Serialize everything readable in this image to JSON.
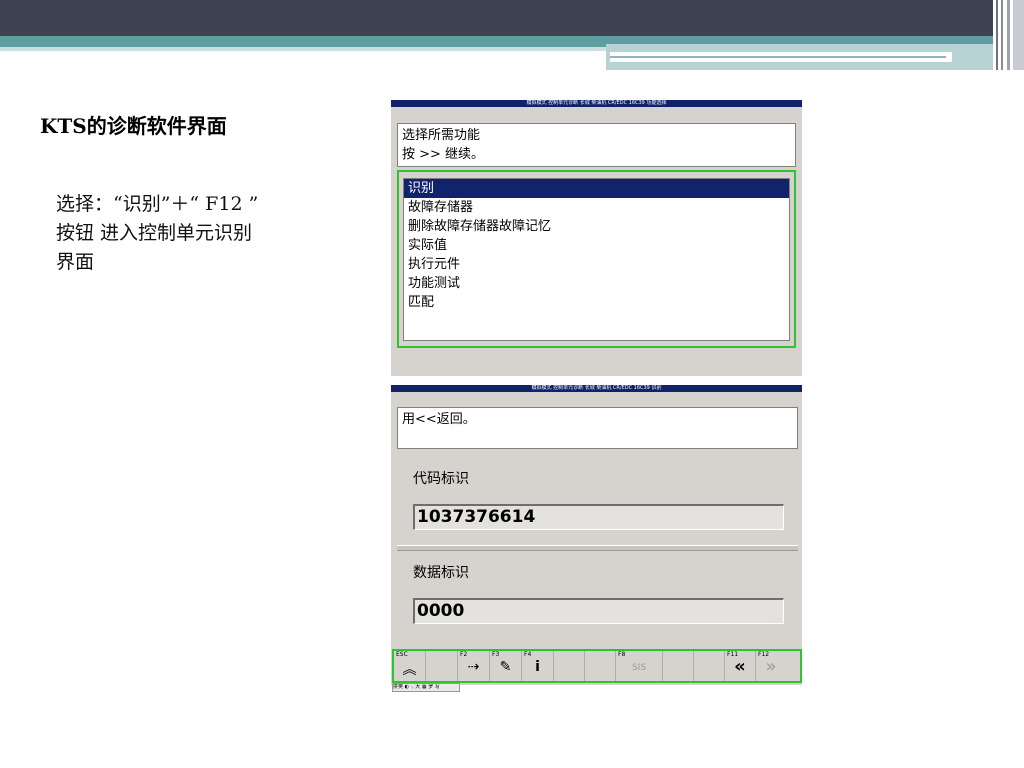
{
  "slide": {
    "title": "KTS的诊断软件界面",
    "body_lines": [
      "选择：“识别”＋“ F12 ”",
      "按钮 进入控制单元识别",
      "界面"
    ],
    "accent_dark": "#3f4251",
    "accent_teal": "#5e9ea0"
  },
  "screen1": {
    "title": "模拟模式 控制单元诊断 长城 柴油机 CR/EDC 16C39 功能选择",
    "instructions": [
      "选择所需功能",
      "按 >> 继续。"
    ],
    "menu": [
      "识别",
      "故障存储器",
      "删除故障存储器故障记忆",
      "实际值",
      "执行元件",
      "功能测试",
      "匹配"
    ],
    "selected_index": 0
  },
  "screen2": {
    "title": "模拟模式 控制单元诊断 长城 柴油机 CR/EDC 16C39 识别",
    "instruction": "用<<返回。",
    "code_label": "代码标识",
    "code_value": "1037376614",
    "data_label": "数据标识",
    "data_value": "0000",
    "fkeys": [
      {
        "label": "ESC",
        "icon": "double-up-chevron-icon",
        "glyph": "︽"
      },
      {
        "label": "",
        "icon": "",
        "glyph": ""
      },
      {
        "label": "F2",
        "icon": "arrow-diamond-icon",
        "glyph": "⇢"
      },
      {
        "label": "F3",
        "icon": "edit-icon",
        "glyph": "✎"
      },
      {
        "label": "F4",
        "icon": "info-icon",
        "glyph": "i"
      },
      {
        "label": "",
        "icon": "",
        "glyph": ""
      },
      {
        "label": "",
        "icon": "",
        "glyph": ""
      },
      {
        "label": "F8",
        "icon": "sis-icon",
        "glyph": "SIS"
      },
      {
        "label": "",
        "icon": "",
        "glyph": ""
      },
      {
        "label": "",
        "icon": "",
        "glyph": ""
      },
      {
        "label": "F11",
        "icon": "double-left-chevron-icon",
        "glyph": "«"
      },
      {
        "label": "F12",
        "icon": "double-right-chevron-icon",
        "glyph": "»"
      }
    ],
    "taskbar": "拼英 ◐ ·, 大 ▦ 罗 写"
  }
}
